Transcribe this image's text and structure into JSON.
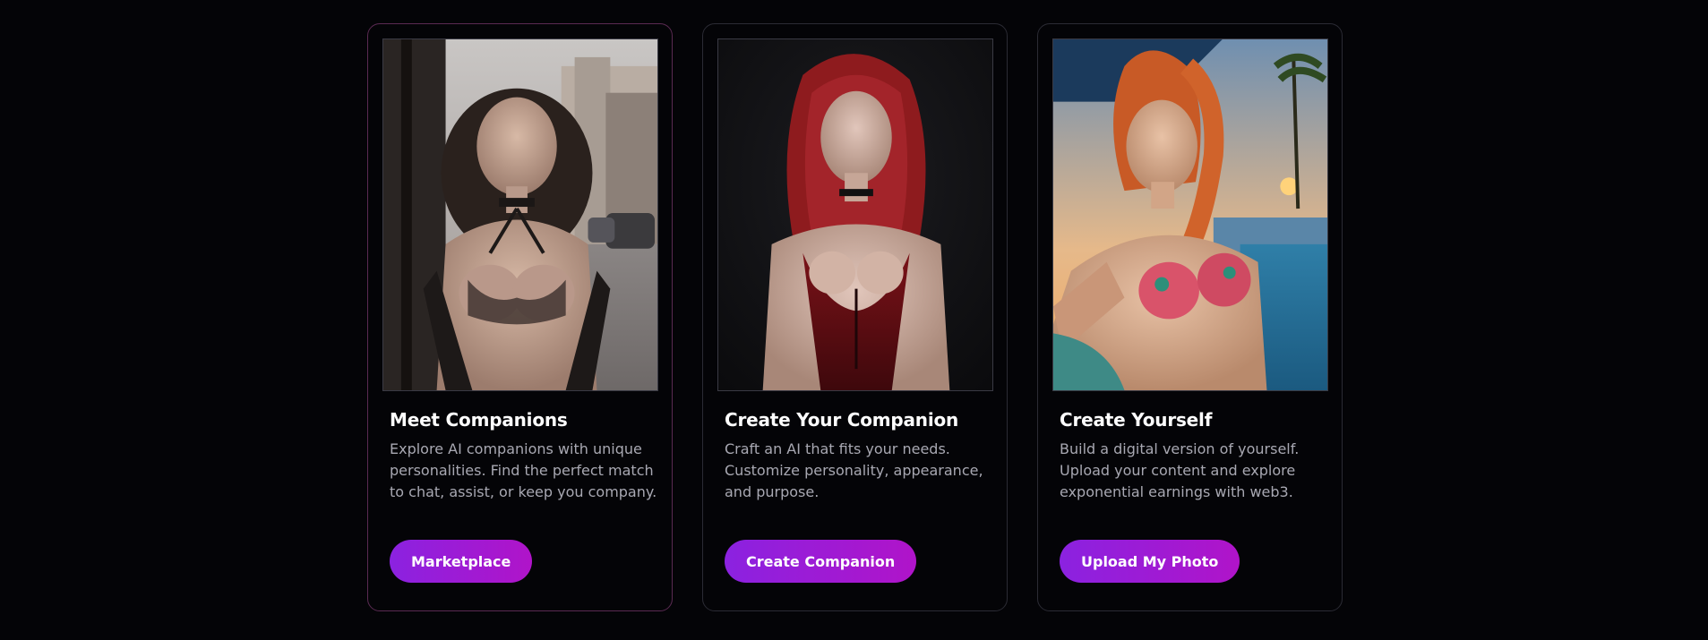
{
  "cards": [
    {
      "title": "Meet Companions",
      "description": "Explore AI companions with unique personalities. Find the perfect match to chat, assist, or keep you company.",
      "button_label": "Marketplace",
      "image_icon": "companion-photo-street"
    },
    {
      "title": "Create Your Companion",
      "description": "Craft an AI that fits your needs. Customize personality, appearance, and purpose.",
      "button_label": "Create Companion",
      "image_icon": "companion-photo-dark"
    },
    {
      "title": "Create Yourself",
      "description": "Build a digital version of yourself. Upload your content and explore exponential earnings with web3.",
      "button_label": "Upload My Photo",
      "image_icon": "companion-photo-pool"
    }
  ],
  "colors": {
    "background": "#040407",
    "button_gradient_start": "#8b22e0",
    "button_gradient_end": "#b014c9",
    "title": "#ffffff",
    "description": "#a8a8b2"
  }
}
